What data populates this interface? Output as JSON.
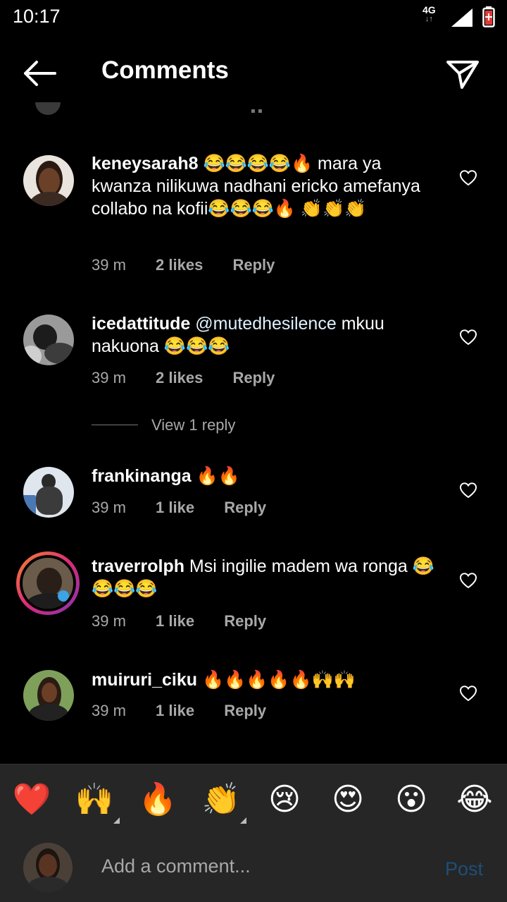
{
  "status_bar": {
    "time": "10:17",
    "network": "4G"
  },
  "header": {
    "title": "Comments"
  },
  "comments": [
    {
      "username": "keneysarah8",
      "text": " 😂😂😂😂🔥 mara ya kwanza nilikuwa nadhani ericko amefanya collabo  na kofii😂😂😂🔥 👏👏👏",
      "time": "39 m",
      "likes": "2 likes",
      "reply": "Reply"
    },
    {
      "username": "icedattitude",
      "mention": "@mutedhesilence",
      "text": " mkuu nakuona 😂😂😂",
      "time": "39 m",
      "likes": "2 likes",
      "reply": "Reply"
    },
    {
      "username": "frankinanga",
      "text": " 🔥🔥",
      "time": "39 m",
      "likes": "1 like",
      "reply": "Reply"
    },
    {
      "username": "traverrolph",
      "text": " Msi ingilie madem wa ronga 😂😂😂😂",
      "time": "39 m",
      "likes": "1 like",
      "reply": "Reply"
    },
    {
      "username": "muiruri_ciku",
      "text": " 🔥🔥🔥🔥🔥🙌🙌",
      "time": "39 m",
      "likes": "1 like",
      "reply": "Reply"
    }
  ],
  "view_replies": "View 1 reply",
  "emoji_bar": [
    "❤️",
    "🙌",
    "🔥",
    "👏",
    "😢",
    "😍",
    "😮",
    "😂"
  ],
  "input": {
    "placeholder": "Add a comment...",
    "post_label": "Post"
  },
  "colors": {
    "background": "#000000",
    "secondary_text": "#a8a8a8",
    "post_disabled": "#1c4f7a",
    "bar_bg": "#262626"
  }
}
